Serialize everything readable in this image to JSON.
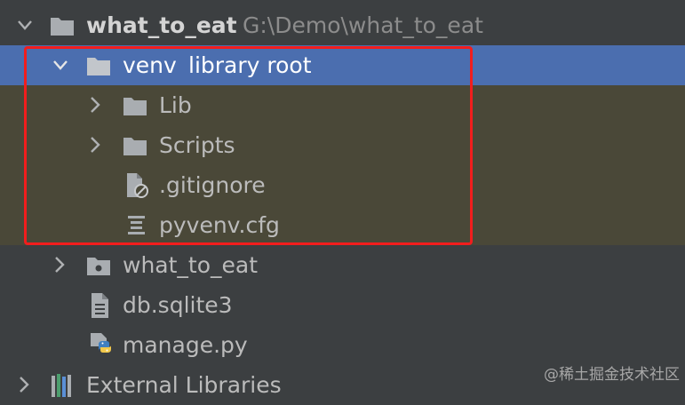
{
  "tree": {
    "project": {
      "name": "what_to_eat",
      "path": "G:\\Demo\\what_to_eat"
    },
    "venv": {
      "name": "venv",
      "suffix": "library root"
    },
    "lib": {
      "name": "Lib"
    },
    "scripts": {
      "name": "Scripts"
    },
    "gitignore": {
      "name": ".gitignore"
    },
    "pyvenv": {
      "name": "pyvenv.cfg"
    },
    "pkg": {
      "name": "what_to_eat"
    },
    "db": {
      "name": "db.sqlite3"
    },
    "manage": {
      "name": "manage.py"
    },
    "external": {
      "name": "External Libraries"
    }
  },
  "watermark": "@稀土掘金技术社区",
  "colors": {
    "selection": "#4b6eaf",
    "excluded": "#4a4838",
    "highlight_border": "#f21d1d",
    "folder": "#a9adb1"
  },
  "icons": [
    "chevron-down-icon",
    "chevron-right-icon",
    "folder-icon",
    "ignore-file-icon",
    "config-file-icon",
    "package-icon",
    "file-icon",
    "python-icon",
    "library-icon"
  ]
}
